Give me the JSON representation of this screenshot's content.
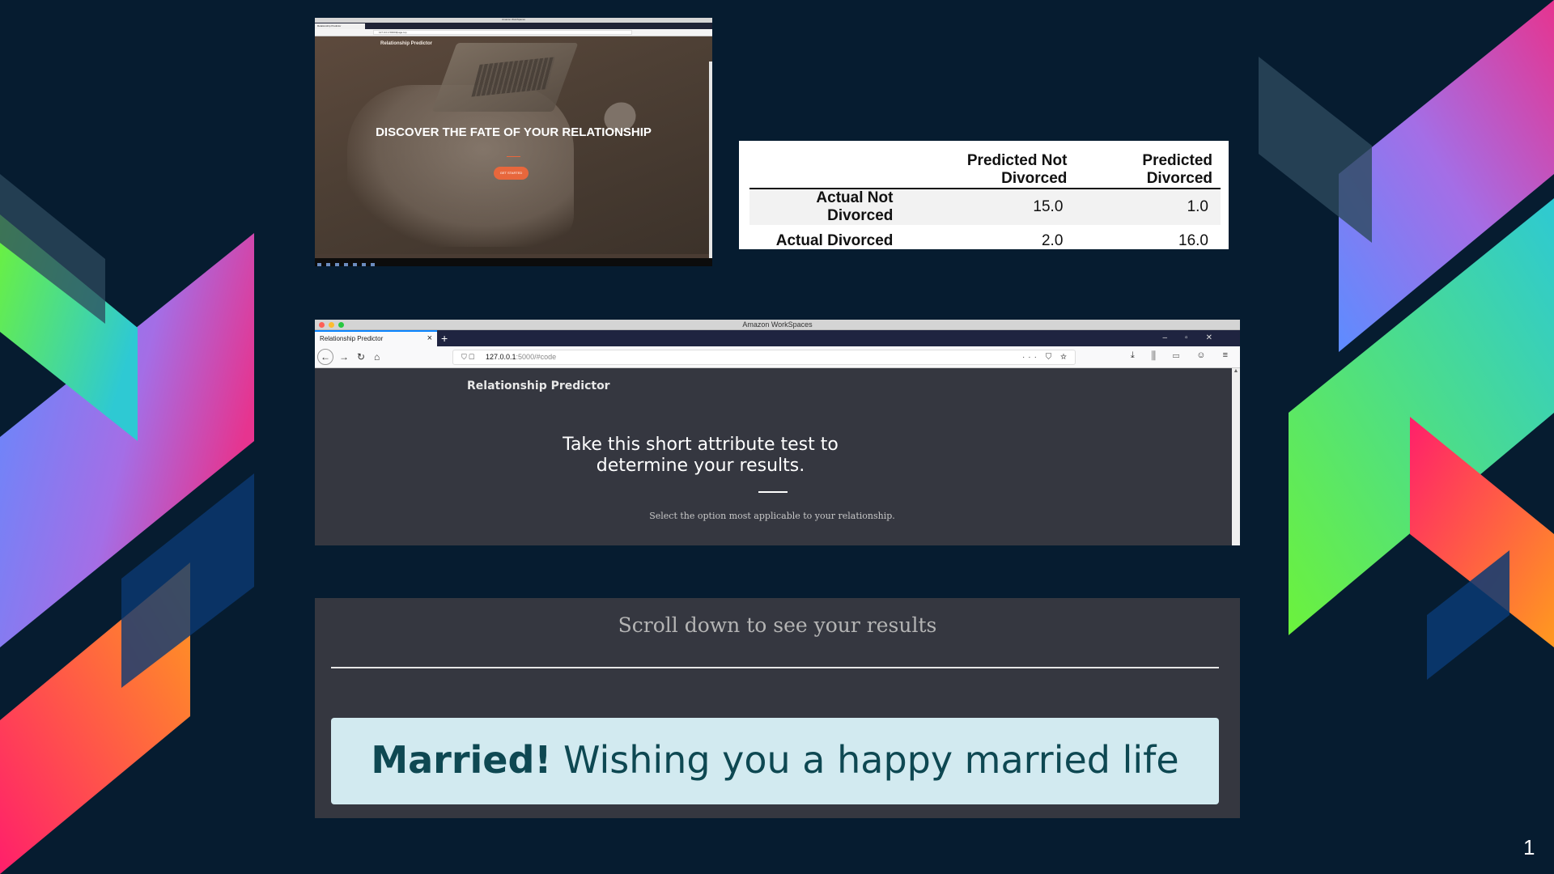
{
  "slide": {
    "page_number": "1"
  },
  "landing_screenshot": {
    "window_title": "Amazon WorkSpaces",
    "tab_title": "Relationship Predictor",
    "url": "127.0.0.1:5000/#page-top",
    "brand": "Relationship Predictor",
    "headline": "DISCOVER THE FATE OF YOUR RELATIONSHIP",
    "cta_label": "GET STARTED"
  },
  "confusion_matrix": {
    "columns": [
      "Predicted Not Divorced",
      "Predicted Divorced"
    ],
    "rows": [
      {
        "label": "Actual Not Divorced",
        "values": [
          "15.0",
          "1.0"
        ]
      },
      {
        "label": "Actual Divorced",
        "values": [
          "2.0",
          "16.0"
        ]
      }
    ]
  },
  "browser": {
    "window_title": "Amazon WorkSpaces",
    "tab_title": "Relationship Predictor",
    "new_tab": "+",
    "url_host": "127.0.0.1",
    "url_rest": ":5000/#code",
    "url_more": "···",
    "window_controls": "–▫✕",
    "toolbar_icons": "⤓ ⫼ ▭ ☺ ≡",
    "page": {
      "brand": "Relationship Predictor",
      "heading": "Take this short attribute test to determine your results.",
      "subtext": "Select the option most applicable to your relationship."
    }
  },
  "results": {
    "scroll_prompt": "Scroll down to see your results",
    "result_bold": "Married!",
    "result_text": "Wishing you a happy married life"
  },
  "colors": {
    "background": "#061c30",
    "panel": "#353740",
    "result_box": "#d2eaf0",
    "result_text": "#0e4852",
    "cta": "#e8673c"
  }
}
